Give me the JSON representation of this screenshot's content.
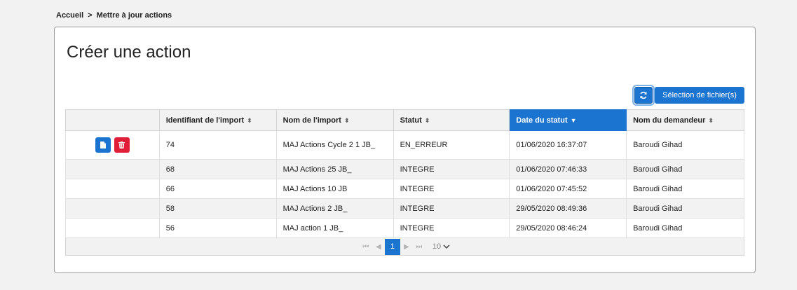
{
  "breadcrumb": {
    "home": "Accueil",
    "separator": ">",
    "current": "Mettre à jour actions"
  },
  "page": {
    "title": "Créer une action"
  },
  "toolbar": {
    "refresh_icon": "refresh-icon",
    "select_files_label": "Sélection de fichier(s)"
  },
  "table": {
    "headers": {
      "actions": "",
      "id": "Identifiant de l'import",
      "name": "Nom de l'import",
      "status": "Statut",
      "status_date": "Date du statut",
      "requester": "Nom du demandeur"
    },
    "sorted_column": "status_date",
    "sort_direction": "desc",
    "rows": [
      {
        "id": "74",
        "name": "MAJ Actions Cycle 2 1 JB_",
        "status": "EN_ERREUR",
        "status_date": "01/06/2020 16:37:07",
        "requester": "Baroudi Gihad"
      },
      {
        "id": "68",
        "name": "MAJ Actions 25 JB_",
        "status": "INTEGRE",
        "status_date": "01/06/2020 07:46:33",
        "requester": "Baroudi Gihad"
      },
      {
        "id": "66",
        "name": "MAJ Actions 10 JB",
        "status": "INTEGRE",
        "status_date": "01/06/2020 07:45:52",
        "requester": "Baroudi Gihad"
      },
      {
        "id": "58",
        "name": "MAJ Actions 2 JB_",
        "status": "INTEGRE",
        "status_date": "29/05/2020 08:49:36",
        "requester": "Baroudi Gihad"
      },
      {
        "id": "56",
        "name": "MAJ action 1 JB_",
        "status": "INTEGRE",
        "status_date": "29/05/2020 08:46:24",
        "requester": "Baroudi Gihad"
      }
    ]
  },
  "pager": {
    "current_page": "1",
    "page_size": "10"
  },
  "colors": {
    "accent": "#1b74cf",
    "danger": "#e01e37"
  }
}
